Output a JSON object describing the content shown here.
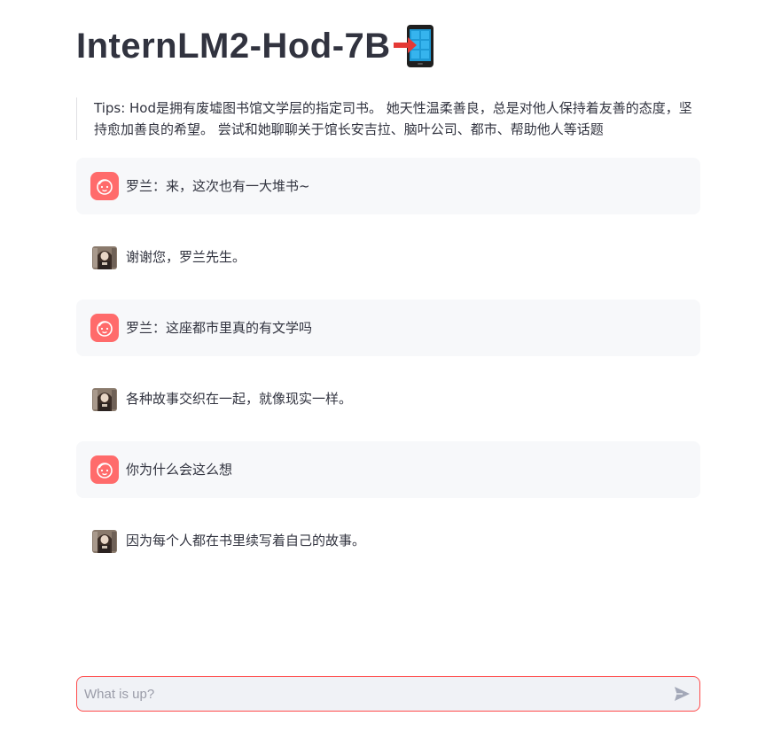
{
  "header": {
    "title": "InternLM2-Hod-7B",
    "title_icon": "mobile-phone-arrow-icon"
  },
  "tips": {
    "text": "Tips: Hod是拥有废墟图书馆文学层的指定司书。 她天性温柔善良，总是对他人保持着友善的态度，坚持愈加善良的希望。 尝试和她聊聊关于馆长安吉拉、脑叶公司、都市、帮助他人等话题"
  },
  "messages": [
    {
      "role": "user",
      "text": "罗兰：来，这次也有一大堆书~"
    },
    {
      "role": "assistant",
      "text": "谢谢您，罗兰先生。"
    },
    {
      "role": "user",
      "text": "罗兰：这座都市里真的有文学吗"
    },
    {
      "role": "assistant",
      "text": "各种故事交织在一起，就像现实一样。"
    },
    {
      "role": "user",
      "text": "你为什么会这么想"
    },
    {
      "role": "assistant",
      "text": "因为每个人都在书里续写着自己的故事。"
    }
  ],
  "chat_input": {
    "placeholder": "What is up?",
    "value": ""
  },
  "colors": {
    "accent": "#ff4b4b",
    "user_avatar": "#ff6b6b",
    "user_bubble": "#f7f8fa",
    "input_bg": "#f0f2f6",
    "text": "#31333f"
  },
  "icons": {
    "user_avatar": "smiley-face-icon",
    "assistant_avatar": "character-portrait-icon",
    "send": "send-arrow-icon"
  }
}
